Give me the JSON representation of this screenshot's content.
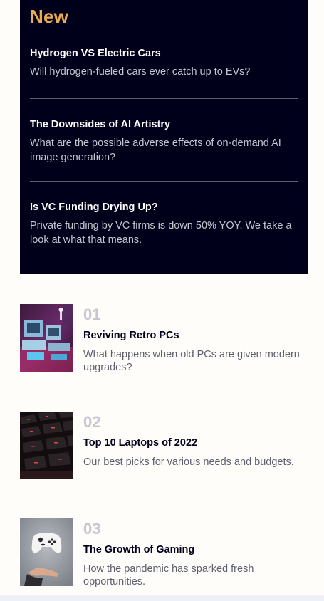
{
  "new_section": {
    "heading": "New",
    "items": [
      {
        "title": "Hydrogen VS Electric Cars",
        "desc": "Will hydrogen-fueled cars ever catch up to EVs?"
      },
      {
        "title": "The Downsides of AI Artistry",
        "desc": "What are the possible adverse effects of on-demand AI image generation?"
      },
      {
        "title": "Is VC Funding Drying Up?",
        "desc": "Private funding by VC firms is down 50% YOY. We take a look at what that means."
      }
    ]
  },
  "list": {
    "items": [
      {
        "number": "01",
        "title": "Reviving Retro PCs",
        "desc": "What happens when old PCs are given modern upgrades?",
        "image_icon": "retro-pc-thumbnail"
      },
      {
        "number": "02",
        "title": "Top 10 Laptops of 2022",
        "desc": "Our best picks for various needs and budgets.",
        "image_icon": "keyboard-thumbnail"
      },
      {
        "number": "03",
        "title": "The Growth of Gaming",
        "desc": "How the pandemic has sparked fresh opportunities.",
        "image_icon": "game-controller-thumbnail"
      }
    ]
  },
  "colors": {
    "dark_bg": "#00001a",
    "accent": "#e9ab53",
    "page_bg": "#fffdf9",
    "muted": "#c5c6d0",
    "body_text": "#5d5f6e"
  }
}
